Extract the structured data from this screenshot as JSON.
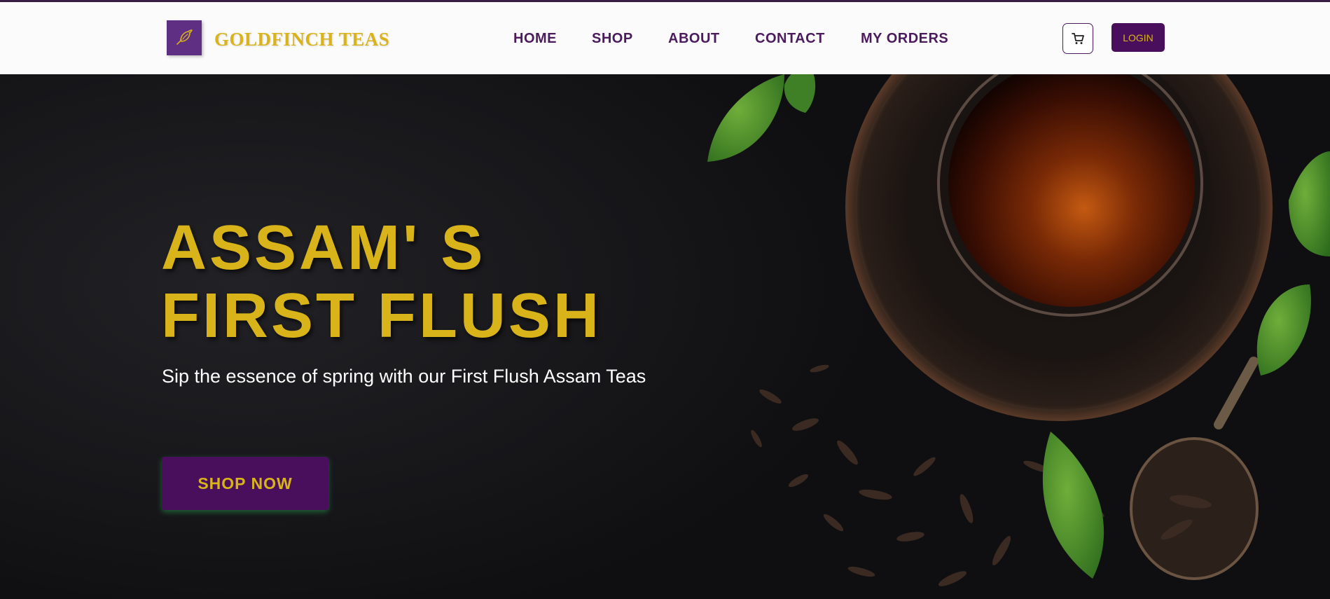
{
  "header": {
    "brand": "GOLDFINCH TEAS",
    "logo_icon": "bird-icon",
    "nav": [
      {
        "label": "HOME"
      },
      {
        "label": "SHOP"
      },
      {
        "label": "ABOUT"
      },
      {
        "label": "CONTACT"
      },
      {
        "label": "MY ORDERS"
      }
    ],
    "cart_icon": "cart-icon",
    "login_label": "LOGIN"
  },
  "hero": {
    "title_line1": "ASSAM' S",
    "title_line2": "FIRST FLUSH",
    "subtitle": "Sip the essence of spring with our First Flush Assam Teas",
    "cta_label": "SHOP NOW",
    "image": "tea-cup-and-leaves-image"
  },
  "colors": {
    "brand_purple": "#4a0f5c",
    "gold": "#d8b41a",
    "header_bg": "#fbfbfc",
    "hero_bg": "#17171a"
  }
}
